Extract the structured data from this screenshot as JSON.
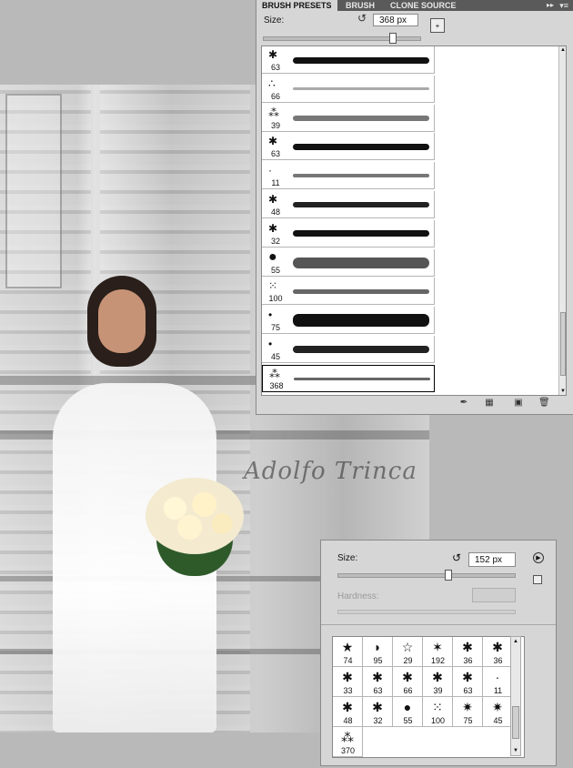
{
  "photo": {
    "watermark": "Adolfo Trinca"
  },
  "brush_presets": {
    "tabs": [
      "BRUSH PRESETS",
      "BRUSH",
      "CLONE SOURCE"
    ],
    "tab_arrows": "▸▸",
    "menu_icon": "▾≡",
    "size_label": "Size:",
    "size_value": "368 px",
    "icons": [
      "reset-size-icon",
      "new-brush-icon",
      "toggle-brush-panel-icon",
      "grid-view-icon",
      "new-preset-icon",
      "delete-icon"
    ],
    "items": [
      {
        "size": "63"
      },
      {
        "size": "66"
      },
      {
        "size": "39"
      },
      {
        "size": "63"
      },
      {
        "size": "11"
      },
      {
        "size": "48"
      },
      {
        "size": "32"
      },
      {
        "size": "55"
      },
      {
        "size": "100"
      },
      {
        "size": "75"
      },
      {
        "size": "45"
      },
      {
        "size": "368"
      }
    ],
    "selected_index": 11
  },
  "brush_picker": {
    "size_label": "Size:",
    "size_value": "152 px",
    "hardness_label": "Hardness:",
    "grid": [
      [
        "74",
        "95",
        "29",
        "192",
        "36",
        "36"
      ],
      [
        "33",
        "63",
        "66",
        "39",
        "63",
        "11"
      ],
      [
        "48",
        "32",
        "55",
        "100",
        "75",
        "45"
      ],
      [
        "370"
      ]
    ]
  }
}
